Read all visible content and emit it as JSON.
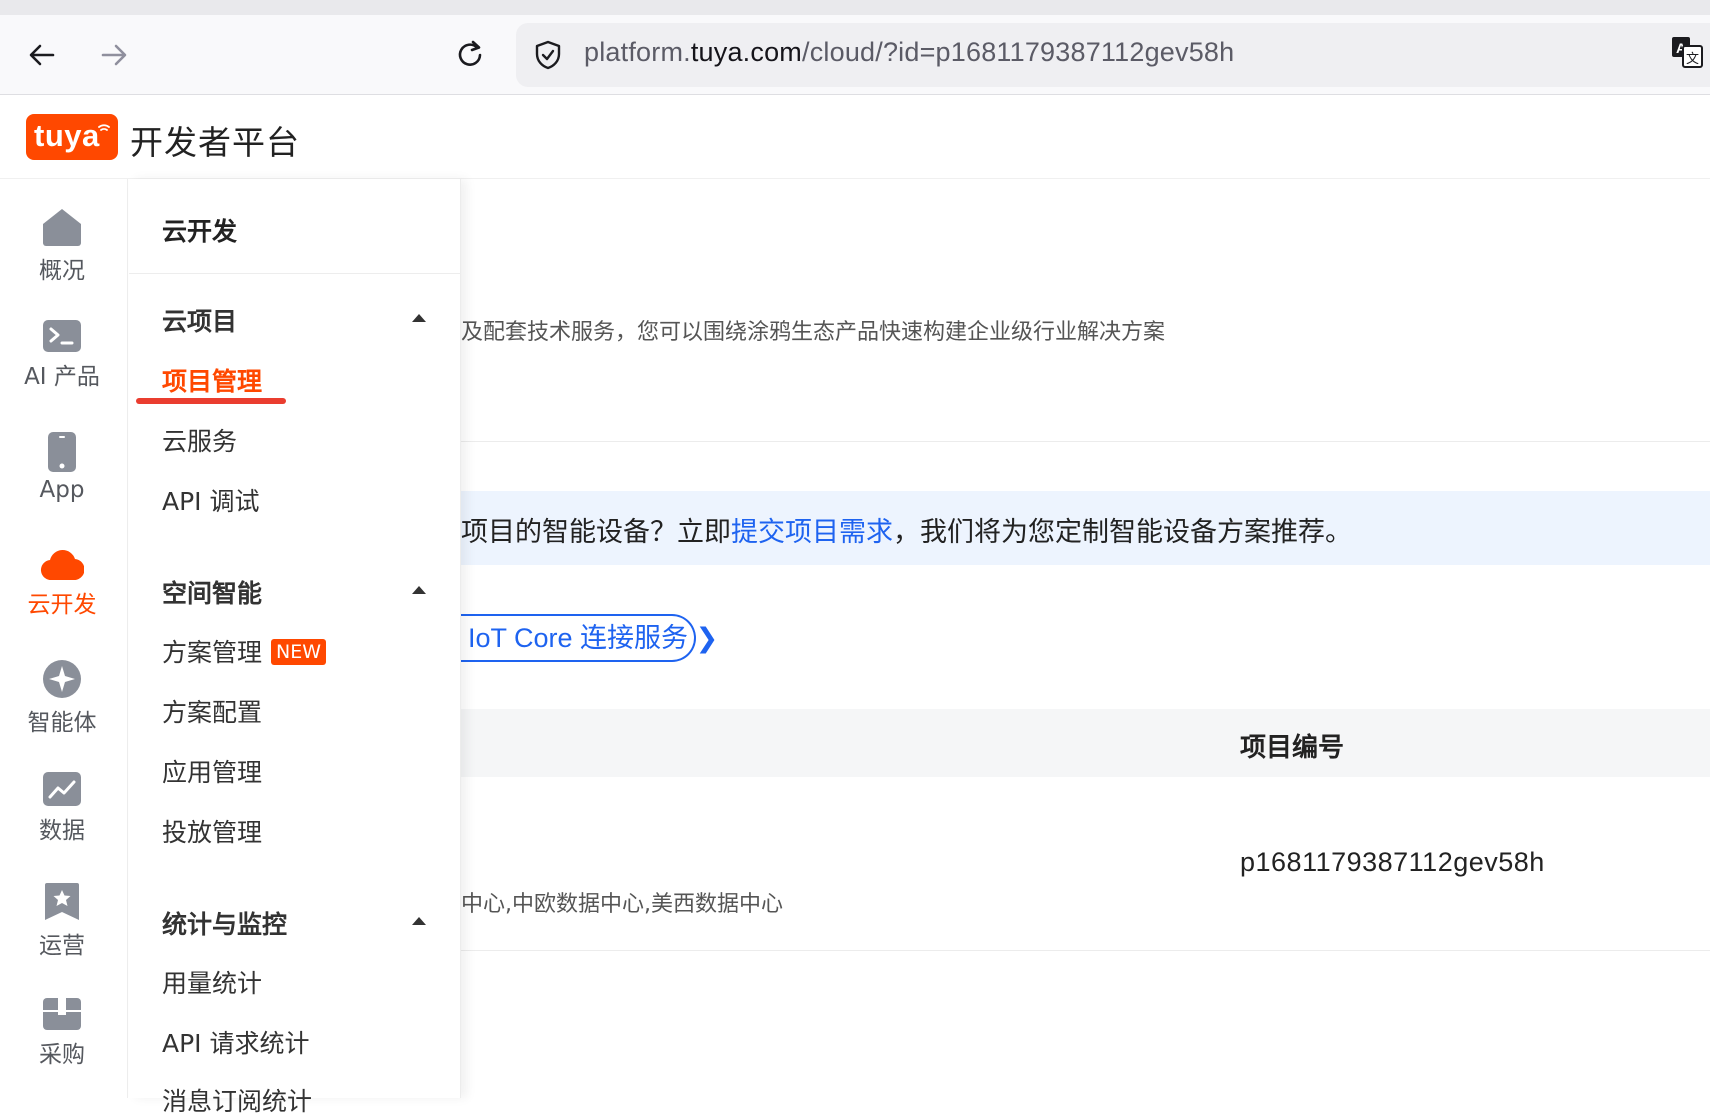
{
  "browser": {
    "url_prefix": "platform.",
    "url_domain": "tuya.com",
    "url_path": "/cloud/?id=p1681179387112gev58h"
  },
  "header": {
    "logo_text": "tuya",
    "title": "开发者平台"
  },
  "rail": {
    "items": [
      {
        "label": "概况",
        "icon": "home-icon"
      },
      {
        "label": "AI 产品",
        "icon": "terminal-icon"
      },
      {
        "label": "App",
        "icon": "phone-icon"
      },
      {
        "label": "云开发",
        "icon": "cloud-icon",
        "active": true
      },
      {
        "label": "智能体",
        "icon": "sparkle-icon"
      },
      {
        "label": "数据",
        "icon": "chart-icon"
      },
      {
        "label": "运营",
        "icon": "bookmark-star-icon"
      },
      {
        "label": "采购",
        "icon": "box-icon"
      }
    ]
  },
  "submenu": {
    "title": "云开发",
    "groups": [
      {
        "label": "云项目",
        "items": [
          "项目管理",
          "云服务",
          "API 调试"
        ]
      },
      {
        "label": "空间智能",
        "items": [
          "方案管理",
          "方案配置",
          "应用管理",
          "投放管理"
        ],
        "badge": "NEW"
      },
      {
        "label": "统计与监控",
        "items": [
          "用量统计",
          "API 请求统计",
          "消息订阅统计"
        ]
      }
    ]
  },
  "main": {
    "description": "及配套技术服务，您可以围绕涂鸦生态产品快速构建企业级行业解决方案",
    "notice_before": "项目的智能设备？立即",
    "notice_link": "提交项目需求",
    "notice_after": "，我们将为您定制智能设备方案推荐。",
    "iot_core_link": "IoT Core 连接服务",
    "table": {
      "column_project_id": "项目编号",
      "row_project_id": "p1681179387112gev58h",
      "row_regions": "中心,中欧数据中心,美西数据中心"
    }
  },
  "colors": {
    "brand": "#ff4800",
    "link": "#1e63f0",
    "notice_bg": "#edf4fe"
  }
}
